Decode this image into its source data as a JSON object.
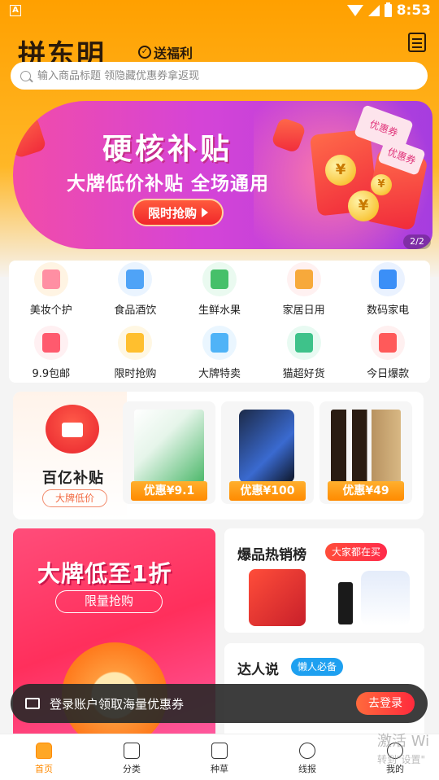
{
  "status": {
    "time": "8:53",
    "app_badge": "A"
  },
  "header": {
    "logo": "拼东明",
    "slogan": "送福利",
    "search_placeholder": "输入商品标题 领隐藏优惠券拿返现"
  },
  "banner": {
    "title": "硬核补贴",
    "subtitle": "大牌低价补贴 全场通用",
    "button": "限时抢购",
    "counter": "2/2",
    "coupon_text": "优惠券",
    "coin": "¥"
  },
  "categories": [
    {
      "label": "美妆个护",
      "color": "#ff8fa3",
      "bg": "#fff4e3"
    },
    {
      "label": "食品酒饮",
      "color": "#4fa3f7",
      "bg": "#eaf4ff"
    },
    {
      "label": "生鲜水果",
      "color": "#46c06a",
      "bg": "#eafaf0"
    },
    {
      "label": "家居日用",
      "color": "#f7a93b",
      "bg": "#fff1f1"
    },
    {
      "label": "数码家电",
      "color": "#3b8ff7",
      "bg": "#eaf2ff"
    },
    {
      "label": "9.9包邮",
      "color": "#ff5a6e",
      "bg": "#fff0f2"
    },
    {
      "label": "限时抢购",
      "color": "#ffbf2e",
      "bg": "#fff7e3"
    },
    {
      "label": "大牌特卖",
      "color": "#4fb3f7",
      "bg": "#eaf6ff"
    },
    {
      "label": "猫超好货",
      "color": "#3ec28a",
      "bg": "#e8faf2"
    },
    {
      "label": "今日爆款",
      "color": "#ff5a5a",
      "bg": "#fff0f0"
    }
  ],
  "subsidy": {
    "title": "百亿补贴",
    "tag": "大牌低价",
    "products": [
      {
        "price": "优惠¥9.1",
        "color": "#4cb86a"
      },
      {
        "price": "优惠¥100",
        "color": "#3a4a6a"
      },
      {
        "price": "优惠¥49",
        "color": "#3a2a1a"
      }
    ]
  },
  "promos": {
    "big_title": "大牌低至1折",
    "big_button": "限量抢购",
    "hot_title": "爆品热销榜",
    "hot_tag": "大家都在买",
    "talk_title": "达人说",
    "talk_tag": "懒人必备"
  },
  "toast": {
    "text": "登录账户领取海量优惠券",
    "button": "去登录"
  },
  "nav": [
    {
      "label": "首页",
      "active": true
    },
    {
      "label": "分类",
      "active": false
    },
    {
      "label": "种草",
      "active": false
    },
    {
      "label": "线报",
      "active": false
    },
    {
      "label": "我的",
      "active": false
    }
  ],
  "watermark": {
    "line1": "激活 Wi",
    "line2": "转到\"设置\""
  }
}
